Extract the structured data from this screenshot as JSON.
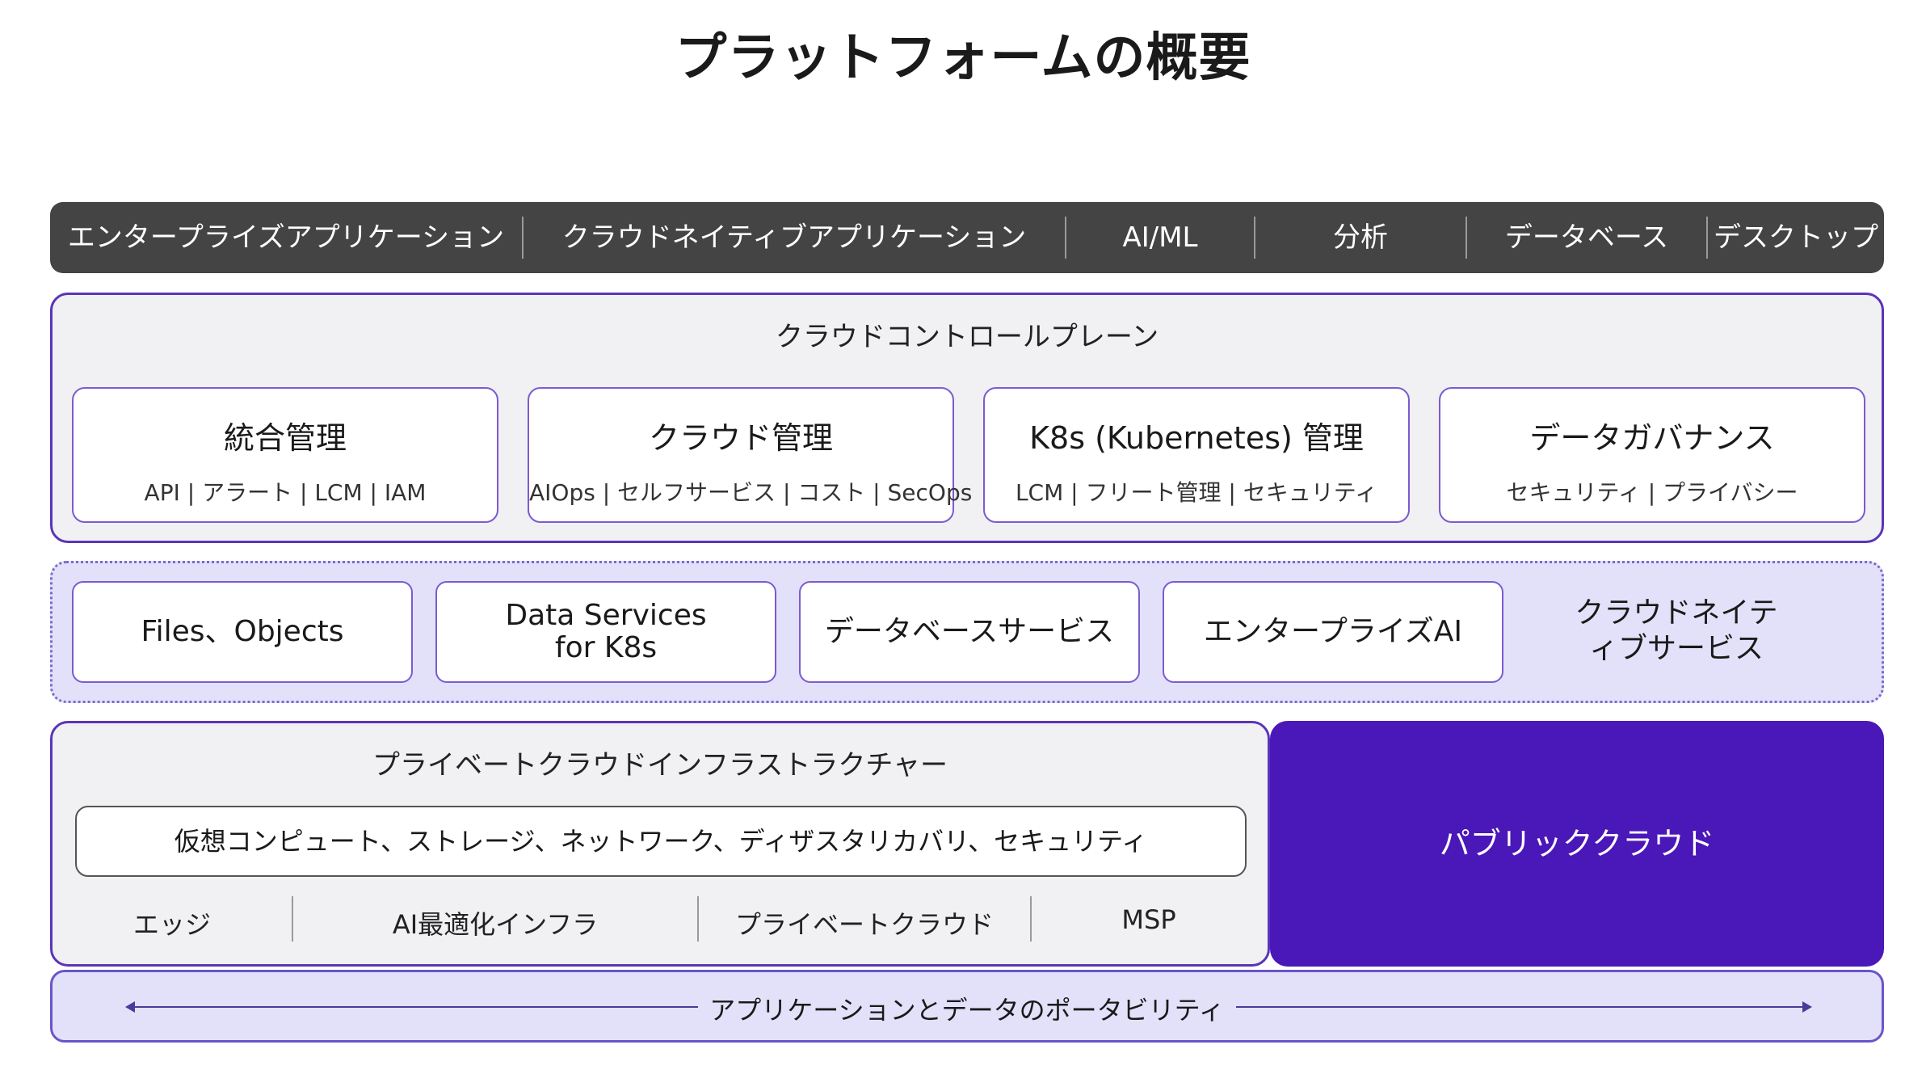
{
  "title": "プラットフォームの概要",
  "applications": [
    "エンタープライズアプリケーション",
    "クラウドネイティブアプリケーション",
    "AI/ML",
    "分析",
    "データベース",
    "デスクトップ"
  ],
  "control_plane": {
    "label": "クラウドコントロールプレーン",
    "cards": [
      {
        "title": "統合管理",
        "sub": "API | アラート | LCM | IAM"
      },
      {
        "title": "クラウド管理",
        "sub": "AIOps | セルフサービス | コスト | SecOps"
      },
      {
        "title": "K8s (Kubernetes) 管理",
        "sub": "LCM | フリート管理 | セキュリティ"
      },
      {
        "title": "データガバナンス",
        "sub": "セキュリティ | プライバシー"
      }
    ]
  },
  "cloud_native_services": {
    "items": [
      "Files、Objects",
      "Data Services for K8s",
      "データベースサービス",
      "エンタープライズAI"
    ],
    "label": "クラウドネイティブサービス"
  },
  "private_infra": {
    "label": "プライベートクラウドインフラストラクチャー",
    "bar": "仮想コンピュート、ストレージ、ネットワーク、ディザスタリカバリ、セキュリティ",
    "items": [
      "エッジ",
      "AI最適化インフラ",
      "プライベートクラウド",
      "MSP"
    ]
  },
  "public_cloud": "パブリッククラウド",
  "portability": "アプリケーションとデータのポータビリティ",
  "colors": {
    "app_bar": "#444444",
    "accent_purple": "#4a17b8",
    "border_purple": "#5a35b8",
    "light_lavender": "#e3e1fa",
    "panel_gray": "#f1f0f3"
  }
}
